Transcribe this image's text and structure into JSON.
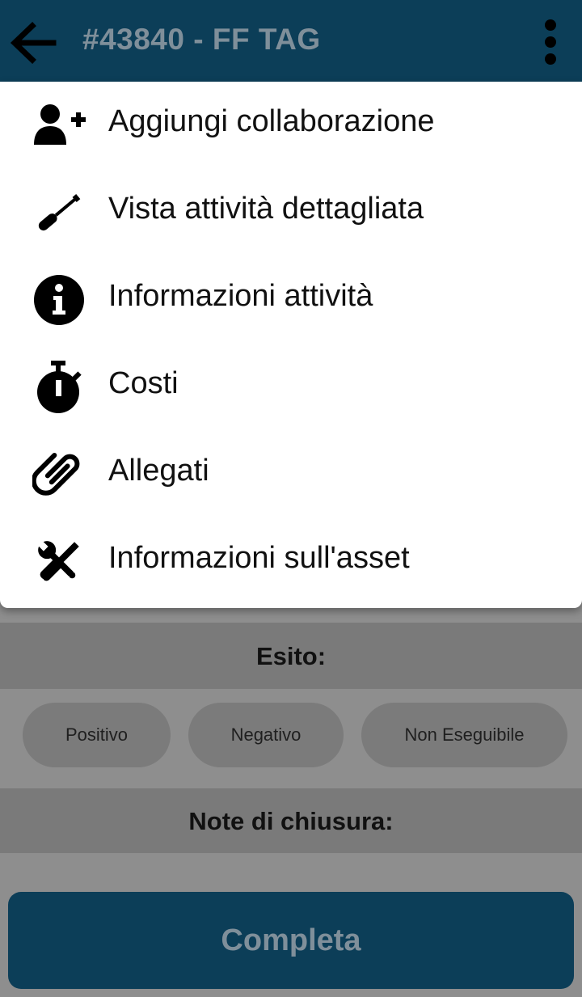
{
  "appbar": {
    "title": "#43840 - FF TAG",
    "back_icon": "arrow-left-icon",
    "more_icon": "more-vertical-icon"
  },
  "menu": {
    "items": [
      {
        "label": "Aggiungi collaborazione",
        "icon": "user-plus-icon"
      },
      {
        "label": "Vista attività dettagliata",
        "icon": "screwdriver-icon"
      },
      {
        "label": "Informazioni attività",
        "icon": "info-circle-icon"
      },
      {
        "label": "Costi",
        "icon": "stopwatch-icon"
      },
      {
        "label": "Allegati",
        "icon": "paperclip-icon"
      },
      {
        "label": "Informazioni sull'asset",
        "icon": "tools-icon"
      }
    ]
  },
  "form": {
    "outcome_label": "Esito:",
    "outcome_options": [
      "Positivo",
      "Negativo",
      "Non Eseguibile"
    ],
    "notes_label": "Note di chiusura:",
    "complete_label": "Completa"
  },
  "colors": {
    "primary": "#0c3e58",
    "overlay_background": "#8e8e8e",
    "menu_background": "#ffffff"
  }
}
